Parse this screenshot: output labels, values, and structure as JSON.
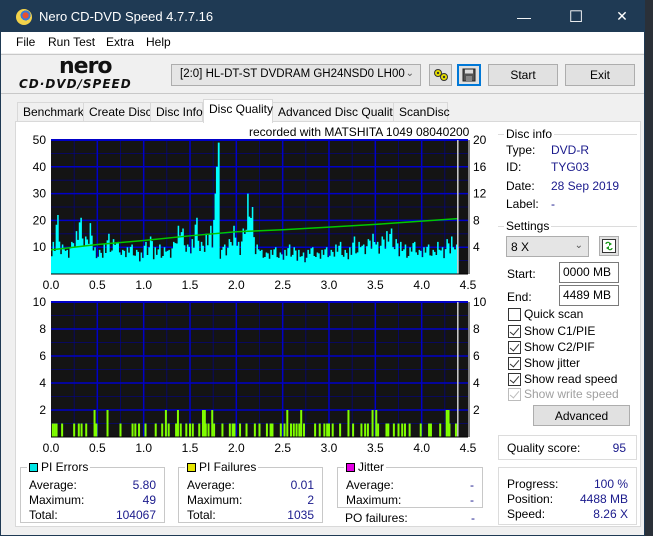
{
  "window": {
    "title": "Nero CD-DVD Speed 4.7.7.16",
    "controls": {
      "minimize": "—",
      "maximize": "☐",
      "close": "✕"
    }
  },
  "menu": [
    "File",
    "Run Test",
    "Extra",
    "Help"
  ],
  "toolbar": {
    "logo_top": "nero",
    "logo_bottom": "CD·DVD∕SPEED",
    "drive": "[2:0]   HL-DT-ST DVDRAM GH24NSD0 LH00",
    "start_label": "Start",
    "exit_label": "Exit",
    "icons": [
      "drive-settings-icon",
      "save-icon"
    ]
  },
  "tabs": [
    {
      "label": "Benchmark",
      "active": false
    },
    {
      "label": "Create Disc",
      "active": false
    },
    {
      "label": "Disc Info",
      "active": false
    },
    {
      "label": "Disc Quality",
      "active": true
    },
    {
      "label": "Advanced Disc Quality",
      "active": false
    },
    {
      "label": "ScanDisc",
      "active": false
    }
  ],
  "recorded_with": "recorded with MATSHITA 1049 08040200",
  "disc_info": {
    "title": "Disc info",
    "rows": [
      {
        "label": "Type:",
        "value": "DVD-R"
      },
      {
        "label": "ID:",
        "value": "TYG03"
      },
      {
        "label": "Date:",
        "value": "28 Sep 2019"
      },
      {
        "label": "Label:",
        "value": "-"
      }
    ]
  },
  "settings": {
    "title": "Settings",
    "speed": "8 X",
    "start_label": "Start:",
    "start_value": "0000 MB",
    "end_label": "End:",
    "end_value": "4489 MB",
    "checkboxes": [
      {
        "label": "Quick scan",
        "checked": false,
        "enabled": true
      },
      {
        "label": "Show C1/PIE",
        "checked": true,
        "enabled": true
      },
      {
        "label": "Show C2/PIF",
        "checked": true,
        "enabled": true
      },
      {
        "label": "Show jitter",
        "checked": true,
        "enabled": true
      },
      {
        "label": "Show read speed",
        "checked": true,
        "enabled": true
      },
      {
        "label": "Show write speed",
        "checked": true,
        "enabled": false
      }
    ],
    "advanced_label": "Advanced"
  },
  "quality": {
    "label": "Quality score:",
    "value": "95"
  },
  "progress": {
    "rows": [
      {
        "label": "Progress:",
        "value": "100 %"
      },
      {
        "label": "Position:",
        "value": "4488 MB"
      },
      {
        "label": "Speed:",
        "value": "8.26 X"
      }
    ]
  },
  "stats": {
    "pi_errors": {
      "title": "PI Errors",
      "color": "#00e5e5",
      "rows": [
        {
          "label": "Average:",
          "value": "5.80"
        },
        {
          "label": "Maximum:",
          "value": "49"
        },
        {
          "label": "Total:",
          "value": "104067"
        }
      ]
    },
    "pi_failures": {
      "title": "PI Failures",
      "color": "#e5e500",
      "rows": [
        {
          "label": "Average:",
          "value": "0.01"
        },
        {
          "label": "Maximum:",
          "value": "2"
        },
        {
          "label": "Total:",
          "value": "1035"
        }
      ]
    },
    "jitter": {
      "title": "Jitter",
      "color": "#e500e5",
      "rows": [
        {
          "label": "Average:",
          "value": "-"
        },
        {
          "label": "Maximum:",
          "value": "-"
        }
      ]
    },
    "po_failures": {
      "label": "PO failures:",
      "value": "-"
    }
  },
  "colors": {
    "plot_bg": "#141414",
    "grid": "#0000c8",
    "pie_fill": "#00ffff",
    "pif_bar": "#80ff00",
    "speed_line": "#00c800",
    "end_marker": "#d0d0d0"
  },
  "chart_data": [
    {
      "type": "area",
      "title": "PI Errors",
      "xlabel": "",
      "ylabel": "",
      "x_ticks": [
        "0.0",
        "0.5",
        "1.0",
        "1.5",
        "2.0",
        "2.5",
        "3.0",
        "3.5",
        "4.0",
        "4.5"
      ],
      "y_ticks_left": [
        "10",
        "20",
        "30",
        "40",
        "50"
      ],
      "y_ticks_right": [
        "4",
        "8",
        "12",
        "16",
        "20"
      ],
      "xlim": [
        0,
        4.5
      ],
      "ylim_left": [
        0,
        50
      ],
      "ylim_right": [
        0,
        20
      ],
      "grid": true,
      "series": [
        {
          "name": "PI Errors",
          "x": [
            0.0,
            0.05,
            0.1,
            0.15,
            0.2,
            0.25,
            0.3,
            0.35,
            0.4,
            0.45,
            0.5,
            0.55,
            0.6,
            0.65,
            0.7,
            0.75,
            0.8,
            0.85,
            0.9,
            0.95,
            1.0,
            1.05,
            1.1,
            1.15,
            1.2,
            1.25,
            1.3,
            1.35,
            1.4,
            1.45,
            1.5,
            1.55,
            1.6,
            1.65,
            1.7,
            1.75,
            1.78,
            1.8,
            1.82,
            1.85,
            1.9,
            1.95,
            2.0,
            2.05,
            2.1,
            2.15,
            2.2,
            2.25,
            2.3,
            2.35,
            2.4,
            2.45,
            2.5,
            2.55,
            2.6,
            2.65,
            2.7,
            2.75,
            2.8,
            2.85,
            2.9,
            2.95,
            3.0,
            3.05,
            3.1,
            3.15,
            3.2,
            3.25,
            3.3,
            3.35,
            3.4,
            3.45,
            3.5,
            3.55,
            3.6,
            3.65,
            3.7,
            3.75,
            3.8,
            3.85,
            3.9,
            3.95,
            4.0,
            4.05,
            4.1,
            4.15,
            4.2,
            4.25,
            4.3,
            4.35,
            4.39
          ],
          "values": [
            12,
            22,
            11,
            9,
            12,
            16,
            21,
            14,
            19,
            10,
            9,
            11,
            15,
            13,
            12,
            9,
            10,
            11,
            9,
            8,
            12,
            14,
            10,
            11,
            10,
            9,
            12,
            18,
            17,
            11,
            13,
            21,
            12,
            15,
            18,
            30,
            40,
            49,
            9,
            11,
            13,
            18,
            12,
            17,
            30,
            25,
            11,
            9,
            8,
            9,
            10,
            8,
            9,
            11,
            10,
            9,
            8,
            9,
            10,
            8,
            9,
            10,
            9,
            11,
            12,
            9,
            10,
            14,
            12,
            11,
            13,
            15,
            12,
            14,
            16,
            17,
            13,
            12,
            11,
            10,
            12,
            9,
            10,
            11,
            9,
            12,
            10,
            13,
            14,
            11,
            10
          ]
        },
        {
          "name": "Read speed",
          "axis": "right",
          "x": [
            0.0,
            0.5,
            1.0,
            1.5,
            2.0,
            2.5,
            3.0,
            3.5,
            4.0,
            4.39
          ],
          "values": [
            3.6,
            4.4,
            5.0,
            5.7,
            6.3,
            6.6,
            7.0,
            7.4,
            7.9,
            8.26
          ]
        }
      ]
    },
    {
      "type": "bar",
      "title": "PI Failures",
      "x_ticks": [
        "0.0",
        "0.5",
        "1.0",
        "1.5",
        "2.0",
        "2.5",
        "3.0",
        "3.5",
        "4.0",
        "4.5"
      ],
      "y_ticks_left": [
        "2",
        "4",
        "6",
        "8",
        "10"
      ],
      "y_ticks_right": [
        "2",
        "4",
        "6",
        "8",
        "10"
      ],
      "xlim": [
        0,
        4.5
      ],
      "ylim": [
        0,
        10
      ],
      "grid": true,
      "series": [
        {
          "name": "PI Failures",
          "x": [
            0.02,
            0.04,
            0.06,
            0.12,
            0.25,
            0.3,
            0.33,
            0.38,
            0.47,
            0.49,
            0.61,
            0.75,
            0.88,
            0.91,
            0.95,
            1.02,
            1.13,
            1.2,
            1.24,
            1.27,
            1.35,
            1.37,
            1.4,
            1.46,
            1.5,
            1.53,
            1.6,
            1.64,
            1.66,
            1.67,
            1.7,
            1.74,
            1.76,
            1.85,
            1.93,
            1.96,
            1.98,
            2.04,
            2.11,
            2.2,
            2.25,
            2.33,
            2.37,
            2.39,
            2.48,
            2.52,
            2.55,
            2.59,
            2.62,
            2.65,
            2.68,
            2.7,
            2.73,
            2.85,
            2.9,
            2.95,
            2.98,
            3.0,
            3.04,
            3.12,
            3.21,
            3.26,
            3.35,
            3.39,
            3.42,
            3.47,
            3.51,
            3.53,
            3.62,
            3.64,
            3.7,
            3.75,
            3.79,
            3.82,
            3.87,
            3.99,
            4.08,
            4.1,
            4.2,
            4.27,
            4.29,
            4.3,
            4.37
          ],
          "values": [
            1,
            1,
            1,
            1,
            1,
            1,
            1,
            1,
            2,
            1,
            2,
            1,
            1,
            1,
            1,
            1,
            1,
            1,
            2,
            1,
            1,
            2,
            1,
            1,
            1,
            1,
            1,
            2,
            2,
            1,
            1,
            2,
            1,
            1,
            1,
            1,
            1,
            1,
            1,
            1,
            1,
            1,
            1,
            1,
            1,
            1,
            2,
            1,
            1,
            1,
            1,
            2,
            1,
            1,
            1,
            1,
            1,
            1,
            1,
            1,
            2,
            1,
            1,
            1,
            1,
            2,
            2,
            1,
            1,
            1,
            1,
            1,
            1,
            1,
            1,
            1,
            1,
            1,
            1,
            2,
            2,
            1,
            1
          ]
        }
      ]
    }
  ]
}
